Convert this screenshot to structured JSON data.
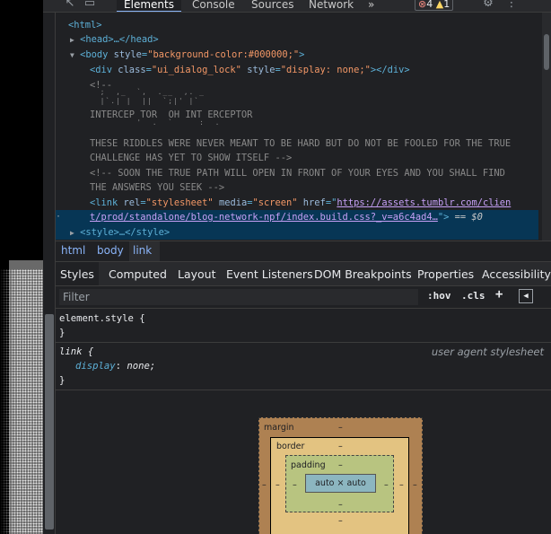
{
  "toolbar": {
    "tabs": [
      "Elements",
      "Console",
      "Sources",
      "Network"
    ],
    "more": "»",
    "errors": "4",
    "warnings": "1"
  },
  "dom": {
    "html_open": "<html>",
    "head": "<head>…</head>",
    "body_tag": "<body",
    "body_attr": "style",
    "body_val": "\"background-color:#000000;\"",
    "div_tag": "<div",
    "div_class_attr": "class",
    "div_class_val": "\"ui_dialog_lock\"",
    "div_style_attr": "style",
    "div_style_val": "\"display: none;\"",
    "div_close": "></div>",
    "comment_open": "<!--",
    "comment_art": "INTERCEP TOR  OH INT ERCEPTOR",
    "riddle1": "THESE RIDDLES WERE NEVER MEANT TO BE HARD BUT DO NOT BE FOOLED FOR THE TRUE",
    "riddle2": "CHALLENGE HAS YET TO SHOW ITSELF -->",
    "riddle3": "<!-- SOON THE TRUE PATH WILL OPEN IN FRONT OF YOUR EYES AND YOU SHALL FIND",
    "riddle4": "THE ANSWERS YOU SEEK -->",
    "link_tag": "<link",
    "link_rel_attr": "rel",
    "link_rel_val": "\"stylesheet\"",
    "link_media_attr": "media",
    "link_media_val": "\"screen\"",
    "link_href_attr": "href",
    "link_href_val1": "https://assets.tumblr.com/clien",
    "link_href_val2": "t/prod/standalone/blog-network-npf/index.build.css?_v=a6c4ad4…",
    "link_close": ">",
    "eq_sel": "== $0",
    "style_tag": "<style>…</style>"
  },
  "breadcrumb": [
    "html",
    "body",
    "link"
  ],
  "sidetabs": [
    "Styles",
    "Computed",
    "Layout",
    "Event Listeners",
    "DOM Breakpoints",
    "Properties",
    "Accessibility"
  ],
  "filter": {
    "placeholder": "Filter",
    "hov": ":hov",
    "cls": ".cls",
    "plus": "+"
  },
  "rules": {
    "element_style": "element.style {",
    "close1": "}",
    "link_sel": "link {",
    "origin": "user agent stylesheet",
    "prop": "display",
    "value": "none;",
    "close2": "}"
  },
  "boxmodel": {
    "margin": "margin",
    "border": "border",
    "padding": "padding",
    "content": "auto × auto",
    "dash": "–"
  }
}
